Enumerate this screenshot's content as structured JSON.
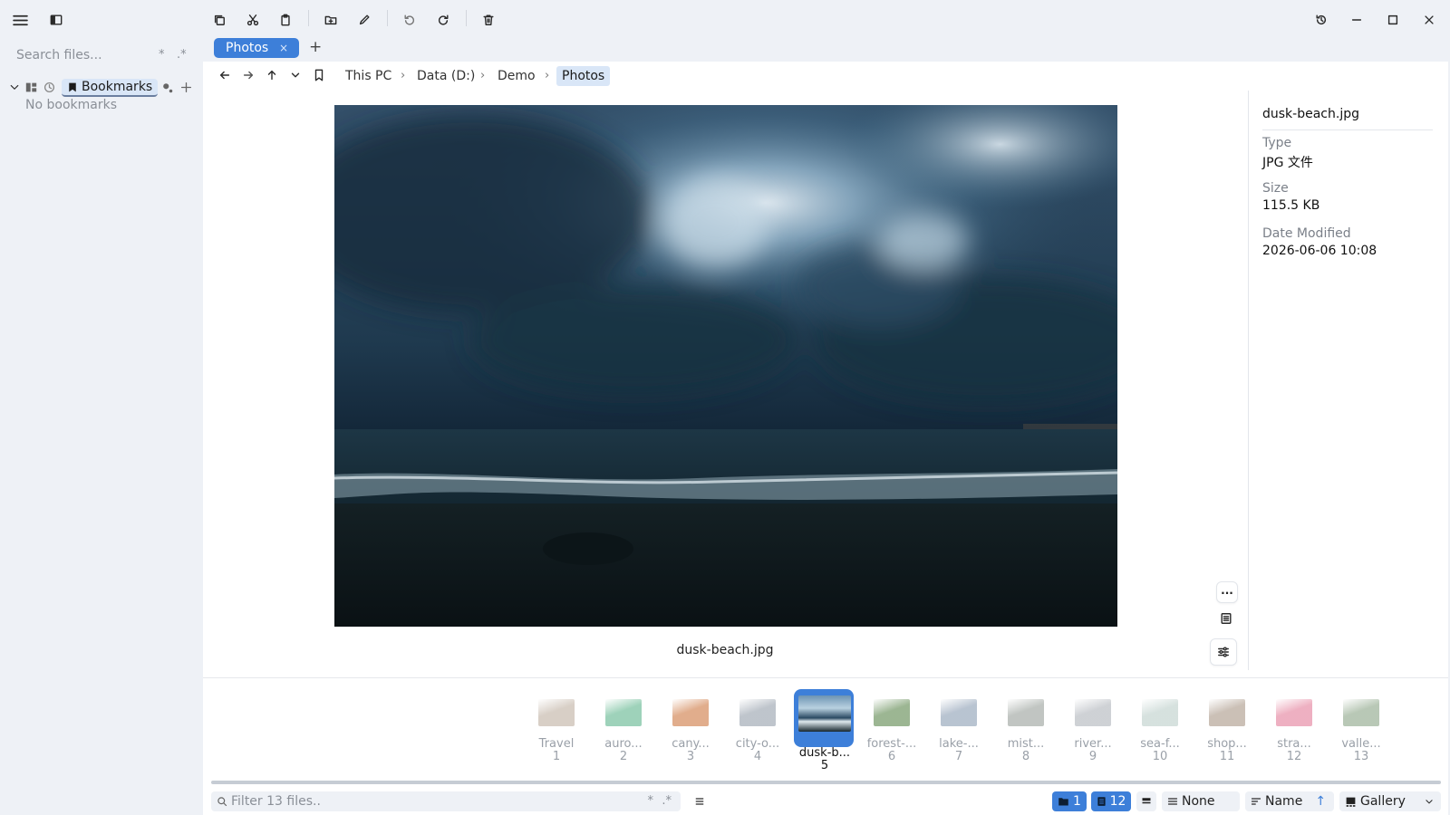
{
  "search": {
    "placeholder": "Search files...",
    "option_star": "*",
    "option_regex": ".*"
  },
  "sidebar": {
    "bookmarks_label": "Bookmarks",
    "empty_text": "No bookmarks"
  },
  "tabs": [
    {
      "label": "Photos",
      "close": "×"
    }
  ],
  "tab_add": "+",
  "breadcrumb": [
    "This PC",
    "Data (D:)",
    "Demo",
    "Photos"
  ],
  "breadcrumb_separator": "›",
  "preview": {
    "file_name": "dusk-beach.jpg"
  },
  "info": {
    "file_name": "dusk-beach.jpg",
    "type_label": "Type",
    "type_value": "JPG 文件",
    "size_label": "Size",
    "size_value": "115.5 KB",
    "date_label": "Date Modified",
    "date_value": "2026-06-06 10:08"
  },
  "side_tools": {
    "more": "..."
  },
  "filmstrip": [
    {
      "label": "Travel",
      "index": "1",
      "color": "#b8a898"
    },
    {
      "label": "auro...",
      "index": "2",
      "color": "#4fae82"
    },
    {
      "label": "cany...",
      "index": "3",
      "color": "#c86a2e"
    },
    {
      "label": "city-o...",
      "index": "4",
      "color": "#8a95a2"
    },
    {
      "label": "dusk-b...",
      "index": "5",
      "color": "#27435a",
      "selected": true
    },
    {
      "label": "forest-...",
      "index": "6",
      "color": "#4b7a3a"
    },
    {
      "label": "lake-...",
      "index": "7",
      "color": "#7f93ab"
    },
    {
      "label": "mist...",
      "index": "8",
      "color": "#8e9690"
    },
    {
      "label": "river...",
      "index": "9",
      "color": "#a7acb3"
    },
    {
      "label": "sea-f...",
      "index": "10",
      "color": "#b5c9c4"
    },
    {
      "label": "shop...",
      "index": "11",
      "color": "#a08c7a"
    },
    {
      "label": "stra...",
      "index": "12",
      "color": "#e0708f"
    },
    {
      "label": "valle...",
      "index": "13",
      "color": "#7f9b7a"
    }
  ],
  "status": {
    "filter_placeholder": "Filter 13 files..",
    "filter_star": "*",
    "filter_regex": ".*",
    "folder_count": "1",
    "file_count": "12",
    "group_value": "None",
    "sort_value": "Name",
    "sort_direction": "↑",
    "view_value": "Gallery"
  },
  "colors": {
    "accent": "#3d7fd9",
    "accent_light": "#d9e6f7",
    "background": "#eef1f6"
  },
  "icons": [
    "hamburger-icon",
    "sidebar-toggle-icon",
    "copy-icon",
    "cut-icon",
    "paste-icon",
    "new-folder-icon",
    "rename-icon",
    "undo-icon",
    "redo-icon",
    "delete-icon",
    "history-icon",
    "minimize-icon",
    "maximize-icon",
    "close-icon"
  ]
}
